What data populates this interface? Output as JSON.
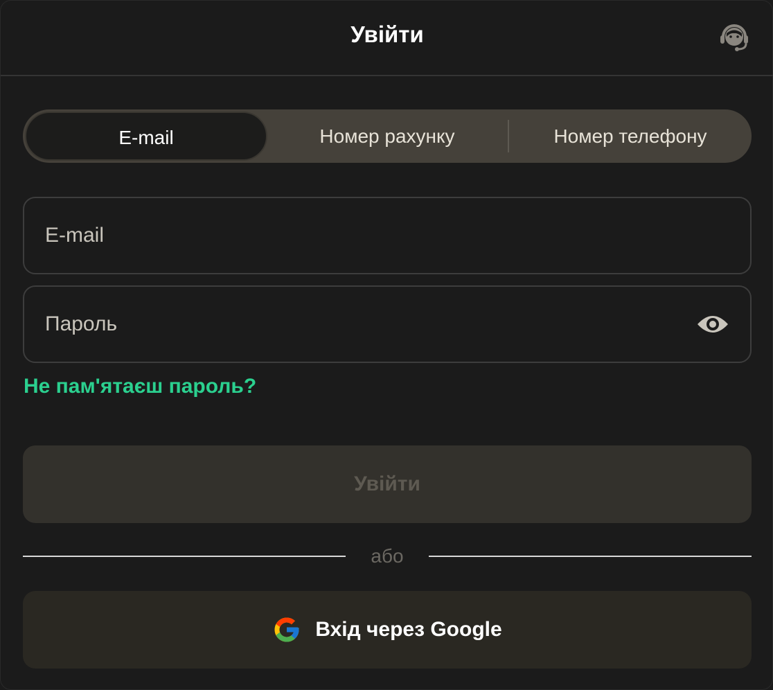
{
  "header": {
    "title": "Увійти",
    "support_icon": "headset-icon"
  },
  "tabs": [
    {
      "label": "E-mail",
      "active": true
    },
    {
      "label": "Номер рахунку",
      "active": false
    },
    {
      "label": "Номер телефону",
      "active": false
    }
  ],
  "form": {
    "email": {
      "placeholder": "E-mail",
      "value": ""
    },
    "password": {
      "placeholder": "Пароль",
      "value": "",
      "toggle_icon": "eye-icon"
    },
    "forgot_label": "Не пам'ятаєш пароль?",
    "submit_label": "Увійти",
    "separator_label": "або",
    "google_label": "Вхід через Google",
    "google_icon": "google-logo-icon"
  },
  "colors": {
    "background": "#1b1b1b",
    "accent": "#2bd08f",
    "tab_bar": "#45413a",
    "disabled_button": "#33312c",
    "google_button": "#2a2822"
  }
}
